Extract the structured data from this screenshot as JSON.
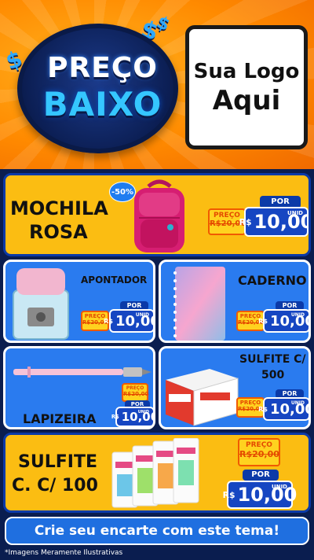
{
  "header": {
    "badge_line1": "PREÇO",
    "badge_line2": "BAIXO",
    "dollar_sign": "$",
    "logo_line1": "Sua Logo",
    "logo_line2": "Aqui"
  },
  "products": [
    {
      "name_line1": "MOCHILA",
      "name_line2": "ROSA",
      "discount": "-50%",
      "preco_label": "PREÇO",
      "old_price": "R$20,00",
      "por_label": "POR",
      "currency": "R$",
      "price": "10,00",
      "unit": "UNID"
    },
    {
      "name": "APONTADOR",
      "preco_label": "PREÇO",
      "old_price": "R$20,00",
      "por_label": "POR",
      "currency": "R$",
      "price": "10,00",
      "unit": "UNID"
    },
    {
      "name": "CADERNO",
      "preco_label": "PREÇO",
      "old_price": "R$20,00",
      "por_label": "POR",
      "currency": "R$",
      "price": "10,00",
      "unit": "UNID"
    },
    {
      "name": "LAPIZEIRA",
      "preco_label": "PREÇO",
      "old_price": "R$20,00",
      "por_label": "POR",
      "currency": "R$",
      "price": "10,00",
      "unit": "UNID"
    },
    {
      "name_line1": "SULFITE C/",
      "name_line2": "500",
      "preco_label": "PREÇO",
      "old_price": "R$20,00",
      "por_label": "POR",
      "currency": "R$",
      "price": "10,00",
      "unit": "UNID"
    },
    {
      "name_line1": "SULFITE",
      "name_line2": "C. C/ 100",
      "preco_label": "PREÇO",
      "old_price": "R$20,00",
      "por_label": "POR",
      "currency": "R$",
      "price": "10,00",
      "unit": "UNID"
    }
  ],
  "footer": {
    "cta": "Crie seu encarte com este tema!",
    "disclaimer": "*Imagens Meramente Ilustrativas"
  },
  "colors": {
    "accent_yellow": "#fbbd12",
    "accent_blue": "#2a7bef",
    "dark_blue": "#0a1d4f",
    "orange": "#ff8a00"
  }
}
